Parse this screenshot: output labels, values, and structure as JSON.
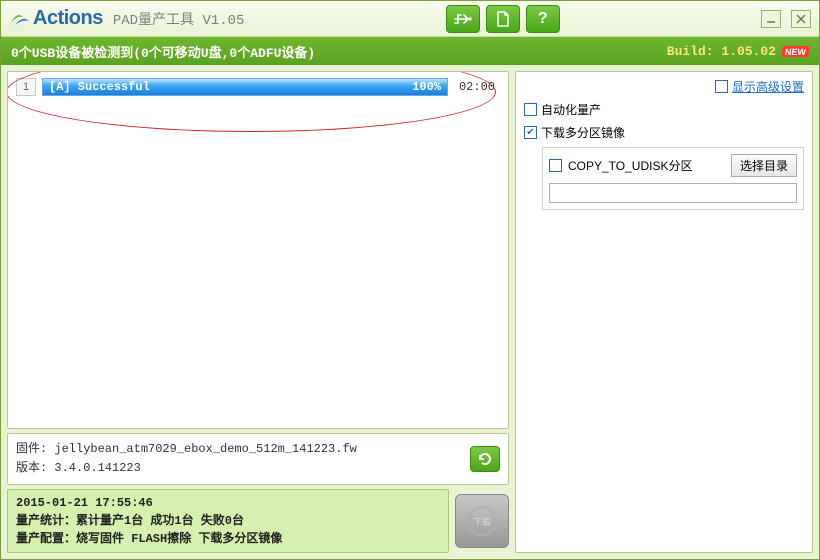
{
  "title": {
    "brand": "Actions",
    "app": "PAD量产工具  V1.05"
  },
  "statusbar": {
    "left": "0个USB设备被检测到(0个可移动U盘,0个ADFU设备)",
    "build_prefix": "Build: ",
    "build_version": "1.05.02",
    "new_label": "NEW"
  },
  "devices": [
    {
      "index": "1",
      "label": "[A] Successful",
      "percent": "100%",
      "time": "02:00"
    }
  ],
  "firmware": {
    "fw_line": "固件: jellybean_atm7029_ebox_demo_512m_141223.fw",
    "ver_line": "版本: 3.4.0.141223"
  },
  "summary": {
    "line1": "2015-01-21 17:55:46",
    "line2": "量产统计：累计量产1台 成功1台 失败0台",
    "line3": "量产配置：烧写固件 FLASH擦除 下载多分区镜像"
  },
  "download_btn": "下载",
  "sidebar": {
    "advanced": "显示高级设置",
    "auto": "自动化量产",
    "multi_part": "下载多分区镜像",
    "copy_udisk": "COPY_TO_UDISK分区",
    "choose_dir": "选择目录"
  }
}
